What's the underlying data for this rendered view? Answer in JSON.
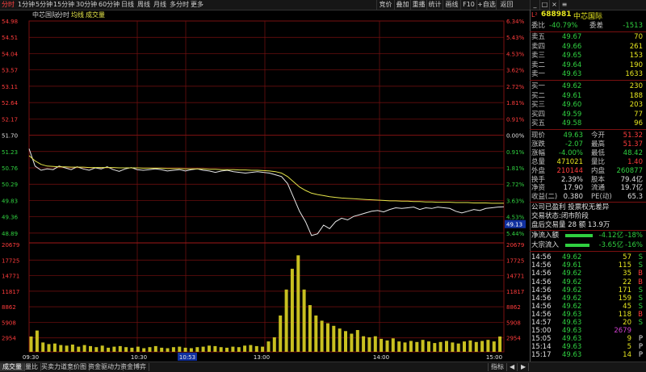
{
  "toolbar": {
    "tabs": [
      "分时",
      "1分钟",
      "5分钟",
      "15分钟",
      "30分钟",
      "60分钟",
      "日线",
      "周线",
      "月线",
      "多分时",
      "更多"
    ],
    "right": [
      "竞价",
      "叠加",
      "重播",
      "统计",
      "画线",
      "F10",
      "+自选",
      "返回"
    ]
  },
  "chart": {
    "stock": "中芯国际",
    "subtitle": "分时",
    "avg_label": "均线",
    "vol_label": "成交量",
    "price_ticks": [
      "54.98",
      "54.51",
      "54.04",
      "53.57",
      "53.11",
      "52.64",
      "52.17",
      "51.70",
      "51.23",
      "50.76",
      "50.29",
      "49.83",
      "49.36",
      "48.89"
    ],
    "pct_left": [
      "6.34%",
      "5.43%",
      "4.53%",
      "3.62%",
      "2.72%",
      "1.81%",
      "0.91%",
      "0.00%",
      "0.91%",
      "1.81%",
      "2.72%",
      "3.63%",
      "4.53%",
      "5.44%"
    ],
    "current_price_tag": "49.13",
    "vol_ticks": [
      "20679",
      "17725",
      "14771",
      "11817",
      "8862",
      "5908",
      "2954"
    ],
    "time_ticks": [
      "09:30",
      "10:30",
      "10:53",
      "13:00",
      "14:00",
      "15:00"
    ],
    "colors": {
      "price": "#e8e8e8",
      "avg": "#e6e64a",
      "vol": "#c8c020",
      "grid": "#7a1010",
      "axis_red": "#ff3c3c",
      "axis_green": "#30d040"
    }
  },
  "chart_data": {
    "type": "line",
    "series": [
      {
        "name": "分时",
        "values": [
          51.3,
          50.8,
          50.68,
          50.72,
          50.7,
          50.8,
          50.75,
          50.7,
          50.78,
          50.72,
          50.68,
          50.75,
          50.72,
          50.78,
          50.7,
          50.65,
          50.72,
          50.76,
          50.7,
          50.68,
          50.7,
          50.72,
          50.7,
          50.66,
          50.68,
          50.7,
          50.66,
          50.7,
          50.72,
          50.68,
          50.66,
          50.62,
          50.66,
          50.68,
          50.64,
          50.62,
          50.6,
          50.62,
          50.64,
          50.62,
          50.6,
          50.55,
          50.5,
          50.3,
          49.9,
          49.5,
          49.2,
          48.8,
          48.85,
          49.1,
          49.0,
          49.2,
          49.3,
          49.25,
          49.35,
          49.4,
          49.45,
          49.5,
          49.52,
          49.48,
          49.55,
          49.6,
          49.58,
          49.6,
          49.62,
          49.55,
          49.6,
          49.58,
          49.62,
          49.6,
          49.58,
          49.5,
          49.45,
          49.5,
          49.55,
          49.52,
          49.58,
          49.6,
          49.62,
          49.63
        ]
      },
      {
        "name": "均线",
        "values": [
          51.1,
          50.95,
          50.85,
          50.8,
          50.79,
          50.78,
          50.78,
          50.77,
          50.77,
          50.77,
          50.76,
          50.76,
          50.76,
          50.76,
          50.76,
          50.75,
          50.75,
          50.75,
          50.75,
          50.74,
          50.74,
          50.74,
          50.74,
          50.73,
          50.73,
          50.73,
          50.72,
          50.72,
          50.72,
          50.72,
          50.71,
          50.71,
          50.7,
          50.7,
          50.7,
          50.69,
          50.69,
          50.68,
          50.68,
          50.67,
          50.66,
          50.64,
          50.6,
          50.5,
          50.35,
          50.2,
          50.1,
          50.02,
          49.98,
          49.95,
          49.92,
          49.9,
          49.88,
          49.87,
          49.86,
          49.85,
          49.84,
          49.83,
          49.82,
          49.81,
          49.8,
          49.8,
          49.79,
          49.79,
          49.78,
          49.78,
          49.77,
          49.77,
          49.76,
          49.76,
          49.76,
          49.75,
          49.75,
          49.75,
          49.74,
          49.74,
          49.74,
          49.73,
          49.73,
          49.73
        ]
      }
    ],
    "volume": [
      2954,
      4100,
      1800,
      1500,
      1600,
      1300,
      1200,
      1400,
      1000,
      1300,
      1100,
      900,
      1200,
      800,
      1000,
      1100,
      900,
      800,
      1000,
      700,
      900,
      1100,
      800,
      700,
      900,
      1000,
      800,
      700,
      900,
      1000,
      1200,
      1100,
      900,
      800,
      1000,
      900,
      1200,
      1300,
      1100,
      1000,
      2000,
      2800,
      7000,
      12000,
      16000,
      18600,
      12000,
      9000,
      7000,
      6000,
      5500,
      5000,
      4500,
      4000,
      3500,
      4200,
      3000,
      2800,
      3000,
      2500,
      2200,
      2600,
      2000,
      1800,
      2100,
      1900,
      2300,
      2000,
      1700,
      1900,
      2100,
      1800,
      1600,
      2000,
      2200,
      1900,
      2100,
      2300,
      2000,
      2954
    ],
    "ylim": [
      48.89,
      54.98
    ],
    "vol_ylim": [
      0,
      20679
    ]
  },
  "panel": {
    "code": "688981",
    "name": "中芯国际",
    "weibi_label": "委比",
    "weibi": "-40.79%",
    "weicha_label": "委差",
    "weicha": "-1513",
    "asks": [
      {
        "label": "卖五",
        "price": "49.67",
        "vol": "70"
      },
      {
        "label": "卖四",
        "price": "49.66",
        "vol": "261"
      },
      {
        "label": "卖三",
        "price": "49.65",
        "vol": "153"
      },
      {
        "label": "卖二",
        "price": "49.64",
        "vol": "190"
      },
      {
        "label": "卖一",
        "price": "49.63",
        "vol": "1633"
      }
    ],
    "bids": [
      {
        "label": "买一",
        "price": "49.62",
        "vol": "230"
      },
      {
        "label": "买二",
        "price": "49.61",
        "vol": "188"
      },
      {
        "label": "买三",
        "price": "49.60",
        "vol": "203"
      },
      {
        "label": "买四",
        "price": "49.59",
        "vol": "77"
      },
      {
        "label": "买五",
        "price": "49.58",
        "vol": "96"
      }
    ],
    "stats": [
      {
        "k1": "现价",
        "v1": "49.63",
        "k2": "今开",
        "v2": "51.32"
      },
      {
        "k1": "涨跌",
        "v1": "-2.07",
        "k2": "最高",
        "v2": "51.37"
      },
      {
        "k1": "涨幅",
        "v1": "-4.00%",
        "k2": "最低",
        "v2": "48.42"
      },
      {
        "k1": "总量",
        "v1": "471021",
        "k2": "量比",
        "v2": "1.40"
      },
      {
        "k1": "外盘",
        "v1": "210144",
        "k2": "内盘",
        "v2": "260877"
      },
      {
        "k1": "换手",
        "v1": "2.39%",
        "k2": "股本",
        "v2": "79.4亿"
      },
      {
        "k1": "净资",
        "v1": "17.90",
        "k2": "流通",
        "v2": "19.7亿"
      },
      {
        "k1": "收益(二)",
        "v1": "0.380",
        "k2": "PE(动)",
        "v2": "65.3"
      }
    ],
    "info1": "公司已盈利 投票权无差异",
    "info2": "交易状态:闭市阶段",
    "info3": "盘后交易量 28 额 13.9万",
    "flow": [
      {
        "label": "净流入额",
        "value": "-4.12亿",
        "pct": "-18%",
        "fill": 0.35
      },
      {
        "label": "大宗流入",
        "value": "-3.65亿",
        "pct": "-16%",
        "fill": 0.3
      }
    ],
    "ticks": [
      {
        "t": "14:56",
        "p": "49.62",
        "v": "57",
        "d": "S"
      },
      {
        "t": "14:56",
        "p": "49.61",
        "v": "115",
        "d": "S"
      },
      {
        "t": "14:56",
        "p": "49.62",
        "v": "35",
        "d": "B"
      },
      {
        "t": "14:56",
        "p": "49.62",
        "v": "22",
        "d": "B"
      },
      {
        "t": "14:56",
        "p": "49.62",
        "v": "171",
        "d": "S"
      },
      {
        "t": "14:56",
        "p": "49.62",
        "v": "159",
        "d": "S"
      },
      {
        "t": "14:56",
        "p": "49.62",
        "v": "45",
        "d": "S"
      },
      {
        "t": "14:56",
        "p": "49.63",
        "v": "118",
        "d": "B"
      },
      {
        "t": "14:57",
        "p": "49.63",
        "v": "20",
        "d": "S"
      },
      {
        "t": "15:00",
        "p": "49.63",
        "v": "2679",
        "d": ""
      },
      {
        "t": "15:05",
        "p": "49.63",
        "v": "9",
        "d": "P"
      },
      {
        "t": "15:14",
        "p": "49.63",
        "v": "5",
        "d": "P"
      },
      {
        "t": "15:17",
        "p": "49.63",
        "v": "14",
        "d": "P"
      }
    ]
  },
  "bottom": {
    "tabs": [
      "成交量",
      "量比",
      "买卖力道",
      "竞价图",
      "资金驱动力",
      "资金博弈"
    ],
    "right": "指标"
  }
}
